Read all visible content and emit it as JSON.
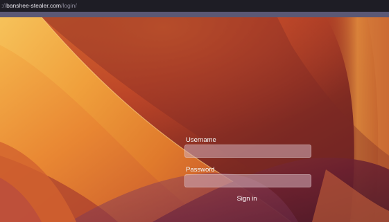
{
  "browser": {
    "url_scheme": "://",
    "url_host": "banshee-stealer.com",
    "url_path": "/login/"
  },
  "login": {
    "username_label": "Username",
    "username_value": "",
    "password_label": "Password",
    "password_value": "",
    "signin_label": "Sign in"
  },
  "colors": {
    "address_bar": "#1e1d25",
    "toolbar_strip": "#5b5875",
    "wallpaper_base": "#8c3222",
    "wallpaper_highlight": "#f2b24a",
    "wallpaper_shadow": "#4a1a28",
    "input_fill": "#d2afb9"
  }
}
